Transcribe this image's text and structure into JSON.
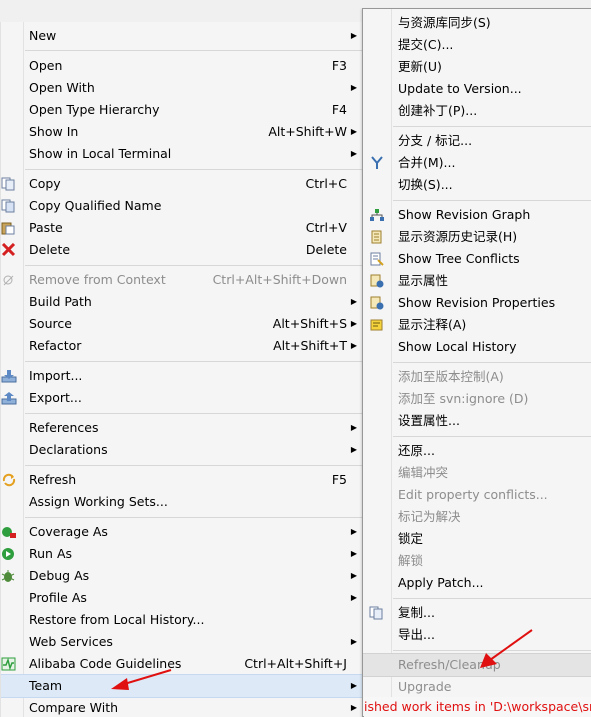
{
  "left_menu": {
    "items": [
      {
        "label": "New",
        "submenu": true
      },
      {
        "label": "Open",
        "shortcut": "F3"
      },
      {
        "label": "Open With",
        "submenu": true
      },
      {
        "label": "Open Type Hierarchy",
        "shortcut": "F4"
      },
      {
        "label": "Show In",
        "shortcut": "Alt+Shift+W",
        "submenu": true
      },
      {
        "label": "Show in Local Terminal",
        "submenu": true
      },
      {
        "label": "Copy",
        "shortcut": "Ctrl+C",
        "icon": "copy-icon"
      },
      {
        "label": "Copy Qualified Name",
        "icon": "copy-qualified-name-icon"
      },
      {
        "label": "Paste",
        "shortcut": "Ctrl+V",
        "icon": "paste-icon"
      },
      {
        "label": "Delete",
        "shortcut": "Delete",
        "icon": "delete-icon"
      },
      {
        "label": "Remove from Context",
        "shortcut": "Ctrl+Alt+Shift+Down",
        "icon": "remove-context-icon",
        "disabled": true
      },
      {
        "label": "Build Path",
        "submenu": true
      },
      {
        "label": "Source",
        "shortcut": "Alt+Shift+S",
        "submenu": true
      },
      {
        "label": "Refactor",
        "shortcut": "Alt+Shift+T",
        "submenu": true
      },
      {
        "label": "Import...",
        "icon": "import-icon"
      },
      {
        "label": "Export...",
        "icon": "export-icon"
      },
      {
        "label": "References",
        "submenu": true
      },
      {
        "label": "Declarations",
        "submenu": true
      },
      {
        "label": "Refresh",
        "shortcut": "F5",
        "icon": "refresh-icon"
      },
      {
        "label": "Assign Working Sets..."
      },
      {
        "label": "Coverage As",
        "submenu": true,
        "icon": "coverage-icon"
      },
      {
        "label": "Run As",
        "submenu": true,
        "icon": "run-icon"
      },
      {
        "label": "Debug As",
        "submenu": true,
        "icon": "debug-icon"
      },
      {
        "label": "Profile As",
        "submenu": true
      },
      {
        "label": "Restore from Local History..."
      },
      {
        "label": "Web Services",
        "submenu": true
      },
      {
        "label": "Alibaba Code Guidelines",
        "shortcut": "Ctrl+Alt+Shift+J",
        "icon": "alibaba-guidelines-icon"
      },
      {
        "label": "Team",
        "submenu": true,
        "selected": true
      },
      {
        "label": "Compare With",
        "submenu": true
      }
    ]
  },
  "right_menu": {
    "items": [
      {
        "label": "与资源库同步(S)"
      },
      {
        "label": "提交(C)..."
      },
      {
        "label": "更新(U)"
      },
      {
        "label": "Update to Version..."
      },
      {
        "label": "创建补丁(P)..."
      },
      {
        "label": "分支 / 标记..."
      },
      {
        "label": "合并(M)...",
        "icon": "merge-icon"
      },
      {
        "label": "切换(S)..."
      },
      {
        "label": "Show Revision Graph",
        "icon": "revision-graph-icon"
      },
      {
        "label": "显示资源历史记录(H)",
        "icon": "history-icon"
      },
      {
        "label": "Show Tree Conflicts",
        "icon": "tree-conflicts-icon"
      },
      {
        "label": "显示属性",
        "icon": "properties-icon"
      },
      {
        "label": "Show Revision Properties",
        "icon": "revision-properties-icon"
      },
      {
        "label": "显示注释(A)",
        "icon": "annotate-icon"
      },
      {
        "label": "Show Local History"
      },
      {
        "label": "添加至版本控制(A)",
        "disabled": true
      },
      {
        "label": "添加至 svn:ignore (D)",
        "disabled": true
      },
      {
        "label": "设置属性..."
      },
      {
        "label": "还原..."
      },
      {
        "label": "编辑冲突",
        "disabled": true
      },
      {
        "label": "Edit property conflicts...",
        "disabled": true
      },
      {
        "label": "标记为解决",
        "disabled": true
      },
      {
        "label": "锁定"
      },
      {
        "label": "解锁",
        "disabled": true
      },
      {
        "label": "Apply Patch..."
      },
      {
        "label": "复制...",
        "icon": "copy-icon"
      },
      {
        "label": "导出..."
      },
      {
        "label": "Refresh/Cleanup",
        "disabled": true,
        "selected": true
      },
      {
        "label": "Upgrade",
        "disabled": true
      }
    ]
  },
  "status_bar": {
    "text": "ished work items in 'D:\\workspace\\sm"
  },
  "colors": {
    "menu_bg": "#f5f5f5",
    "selection": "#dde9f7",
    "disabled_text": "#8d8d8d",
    "annotation_arrow": "#e01010",
    "status_text": "#e01010"
  }
}
